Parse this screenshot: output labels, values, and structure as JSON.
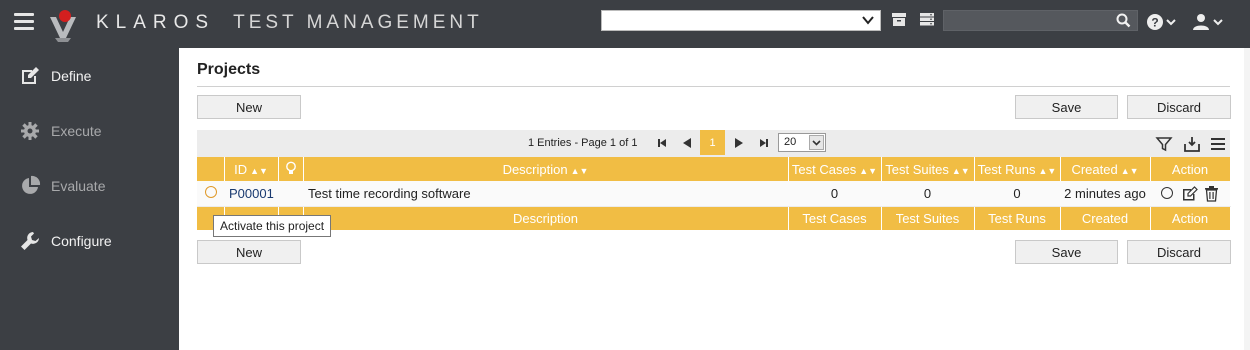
{
  "header": {
    "brand_primary": "KLAROS",
    "brand_secondary": "TEST MANAGEMENT",
    "project_select_value": "",
    "search_placeholder": "",
    "icons": [
      "menu-icon",
      "klaros-logo",
      "archive-icon",
      "server-icon",
      "search-icon",
      "help-icon",
      "user-icon"
    ]
  },
  "sidebar": {
    "items": [
      {
        "label": "Define",
        "icon": "edit-icon",
        "active": true
      },
      {
        "label": "Execute",
        "icon": "gear-icon",
        "active": false
      },
      {
        "label": "Evaluate",
        "icon": "pie-chart-icon",
        "active": false
      },
      {
        "label": "Configure",
        "icon": "wrench-icon",
        "active": true
      }
    ]
  },
  "page": {
    "title": "Projects",
    "new_label": "New",
    "save_label": "Save",
    "discard_label": "Discard"
  },
  "pager": {
    "info": "1 Entries - Page 1 of 1",
    "current_page": "1",
    "page_size": "20"
  },
  "table": {
    "columns": [
      "ID",
      "Description",
      "Test Cases",
      "Test Suites",
      "Test Runs",
      "Created",
      "Action"
    ],
    "footer_columns": [
      "Description",
      "Test Cases",
      "Test Suites",
      "Test Runs",
      "Created",
      "Action"
    ],
    "rows": [
      {
        "id": "P00001",
        "description": "Test time recording software",
        "test_cases": "0",
        "test_suites": "0",
        "test_runs": "0",
        "created": "2 minutes ago"
      }
    ]
  },
  "tooltip": "Activate this project",
  "colors": {
    "header_bg": "#3c3f44",
    "accent": "#f1bd44",
    "link": "#1a3a70"
  }
}
